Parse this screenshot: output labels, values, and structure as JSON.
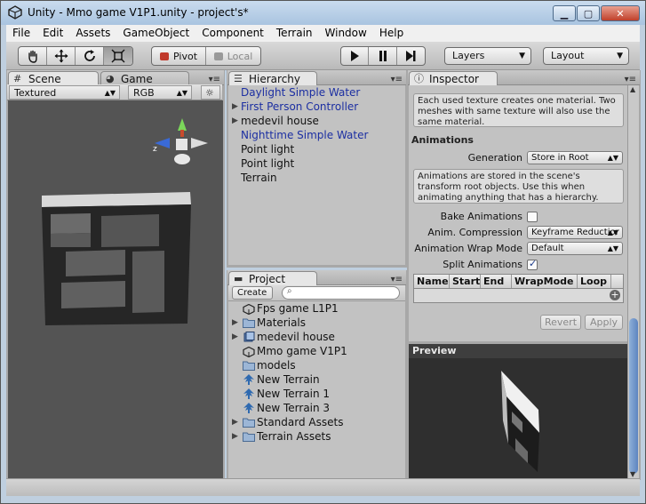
{
  "window": {
    "title": "Unity - Mmo game V1P1.unity - project's*"
  },
  "menu": [
    "File",
    "Edit",
    "Assets",
    "GameObject",
    "Component",
    "Terrain",
    "Window",
    "Help"
  ],
  "toolbar": {
    "pivot_label": "Pivot",
    "local_label": "Local",
    "layers_label": "Layers",
    "layout_label": "Layout"
  },
  "scene": {
    "tab_scene": "Scene",
    "tab_game": "Game",
    "render_mode": "Textured",
    "color_mode": "RGB",
    "gizmo_axis_label": "z"
  },
  "hierarchy": {
    "tab_label": "Hierarchy",
    "items": [
      {
        "label": "Daylight Simple Water",
        "prefab": true,
        "foldout": false
      },
      {
        "label": "First Person Controller",
        "prefab": true,
        "foldout": true
      },
      {
        "label": "medevil house",
        "prefab": false,
        "foldout": true
      },
      {
        "label": "Nighttime Simple Water",
        "prefab": true,
        "foldout": false
      },
      {
        "label": "Point light",
        "prefab": false,
        "foldout": false
      },
      {
        "label": "Point light",
        "prefab": false,
        "foldout": false
      },
      {
        "label": "Terrain",
        "prefab": false,
        "foldout": false
      }
    ]
  },
  "project": {
    "tab_label": "Project",
    "create_label": "Create",
    "items": [
      {
        "label": "Fps game L1P1",
        "icon": "unity-scene-icon",
        "foldout": false
      },
      {
        "label": "Materials",
        "icon": "folder-icon",
        "foldout": true
      },
      {
        "label": "medevil house",
        "icon": "model-prefab-icon",
        "foldout": true
      },
      {
        "label": "Mmo game V1P1",
        "icon": "unity-scene-icon",
        "foldout": false
      },
      {
        "label": "models",
        "icon": "folder-icon",
        "foldout": false
      },
      {
        "label": "New Terrain",
        "icon": "terrain-tree-icon",
        "foldout": false
      },
      {
        "label": "New Terrain 1",
        "icon": "terrain-tree-icon",
        "foldout": false
      },
      {
        "label": "New Terrain 3",
        "icon": "terrain-tree-icon",
        "foldout": false
      },
      {
        "label": "Standard Assets",
        "icon": "folder-icon",
        "foldout": true
      },
      {
        "label": "Terrain Assets",
        "icon": "folder-icon",
        "foldout": true
      }
    ]
  },
  "inspector": {
    "tab_label": "Inspector",
    "material_help": "Each used texture creates one material. Two meshes with same texture will also use the same material.",
    "animations_title": "Animations",
    "generation_label": "Generation",
    "generation_value": "Store in Root",
    "generation_help": "Animations are stored in the scene's transform root objects. Use this when animating anything that has a hierarchy.",
    "bake_label": "Bake Animations",
    "bake_checked": false,
    "compression_label": "Anim. Compression",
    "compression_value": "Keyframe Reductior",
    "wrap_label": "Animation Wrap Mode",
    "wrap_value": "Default",
    "split_label": "Split Animations",
    "split_checked": true,
    "clip_columns": [
      "Name",
      "Start",
      "End",
      "WrapMode",
      "Loop"
    ],
    "revert_label": "Revert",
    "apply_label": "Apply",
    "preview_label": "Preview"
  }
}
